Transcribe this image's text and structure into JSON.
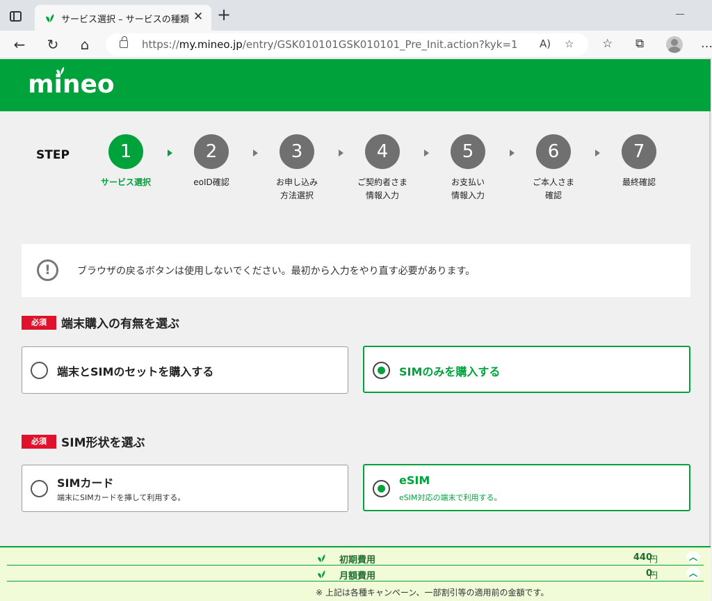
{
  "browser": {
    "tab_title": "サービス選択 – サービスの種類",
    "close_glyph": "✕",
    "new_tab_glyph": "+",
    "url_prefix": "https://",
    "url_host": "my.mineo.jp",
    "url_path": "/entry/GSK010101GSK010101_Pre_Init.action?kyk=1",
    "icons": {
      "back": "←",
      "refresh": "↻",
      "home": "⌂",
      "read_aloud": "A)",
      "favorite_add": "☆",
      "favorites": "☆",
      "collections": "⧉",
      "more": "…"
    }
  },
  "header": {
    "logo_text": "mineo",
    "brand_color": "#00a33b"
  },
  "steps": {
    "label": "STEP",
    "items": [
      {
        "num": "1",
        "line1": "サービス選択",
        "line2": ""
      },
      {
        "num": "2",
        "line1": "eoID確認",
        "line2": ""
      },
      {
        "num": "3",
        "line1": "お申し込み",
        "line2": "方法選択"
      },
      {
        "num": "4",
        "line1": "ご契約者さま",
        "line2": "情報入力"
      },
      {
        "num": "5",
        "line1": "お支払い",
        "line2": "情報入力"
      },
      {
        "num": "6",
        "line1": "ご本人さま",
        "line2": "確認"
      },
      {
        "num": "7",
        "line1": "最終確認",
        "line2": ""
      }
    ],
    "active_index": 0
  },
  "notice": {
    "icon": "!",
    "text": "ブラウザの戻るボタンは使用しないでください。最初から入力をやり直す必要があります。"
  },
  "sections": {
    "required_badge": "必須",
    "device": {
      "title": "端末購入の有無を選ぶ",
      "options": [
        {
          "label": "端末とSIMのセットを購入する",
          "selected": false
        },
        {
          "label": "SIMのみを購入する",
          "selected": true
        }
      ]
    },
    "sim": {
      "title": "SIM形状を選ぶ",
      "options": [
        {
          "label": "SIMカード",
          "sub": "端末にSIMカードを挿して利用する。",
          "selected": false
        },
        {
          "label": "eSIM",
          "sub": "eSIM対応の端末で利用する。",
          "selected": true
        }
      ]
    }
  },
  "fees": {
    "initial": {
      "label": "初期費用",
      "amount": "440",
      "unit": "円"
    },
    "monthly": {
      "label": "月額費用",
      "amount": "0",
      "unit": "円"
    },
    "toggle_glyph": "︿",
    "note": "※ 上記は各種キャンペーン、一部割引等の適用前の金額です。"
  }
}
